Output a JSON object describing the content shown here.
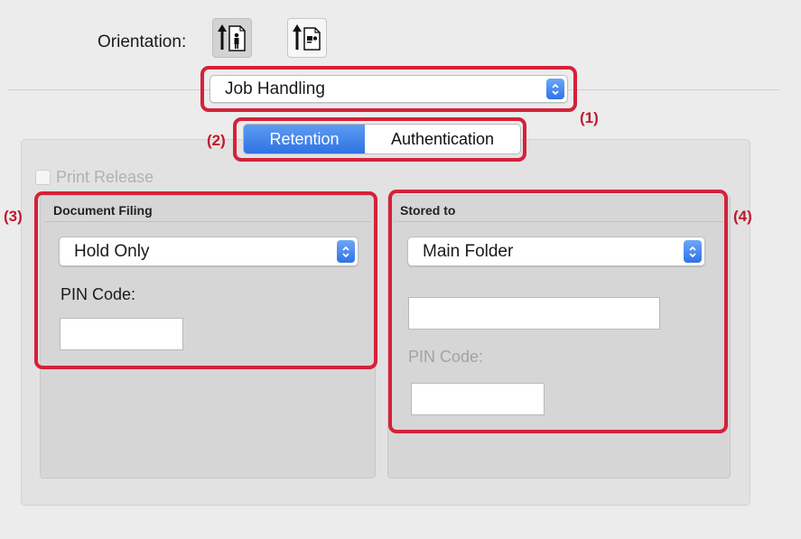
{
  "orientation": {
    "label": "Orientation:",
    "options": [
      {
        "name": "portrait",
        "selected": true
      },
      {
        "name": "landscape",
        "selected": false
      }
    ]
  },
  "panel_menu": {
    "selected": "Job Handling"
  },
  "tabs": [
    {
      "label": "Retention",
      "active": true
    },
    {
      "label": "Authentication",
      "active": false
    }
  ],
  "print_release": {
    "label": "Print Release",
    "checked": false,
    "enabled": false
  },
  "document_filing": {
    "title": "Document Filing",
    "mode": "Hold Only",
    "pin_label": "PIN Code:",
    "pin_value": ""
  },
  "stored_to": {
    "title": "Stored to",
    "folder": "Main Folder",
    "folder_name_value": "",
    "pin_label": "PIN Code:",
    "pin_value": ""
  },
  "callouts": [
    "(1)",
    "(2)",
    "(3)",
    "(4)"
  ],
  "colors": {
    "callout": "#d5213a",
    "accent": "#2f72e2"
  }
}
